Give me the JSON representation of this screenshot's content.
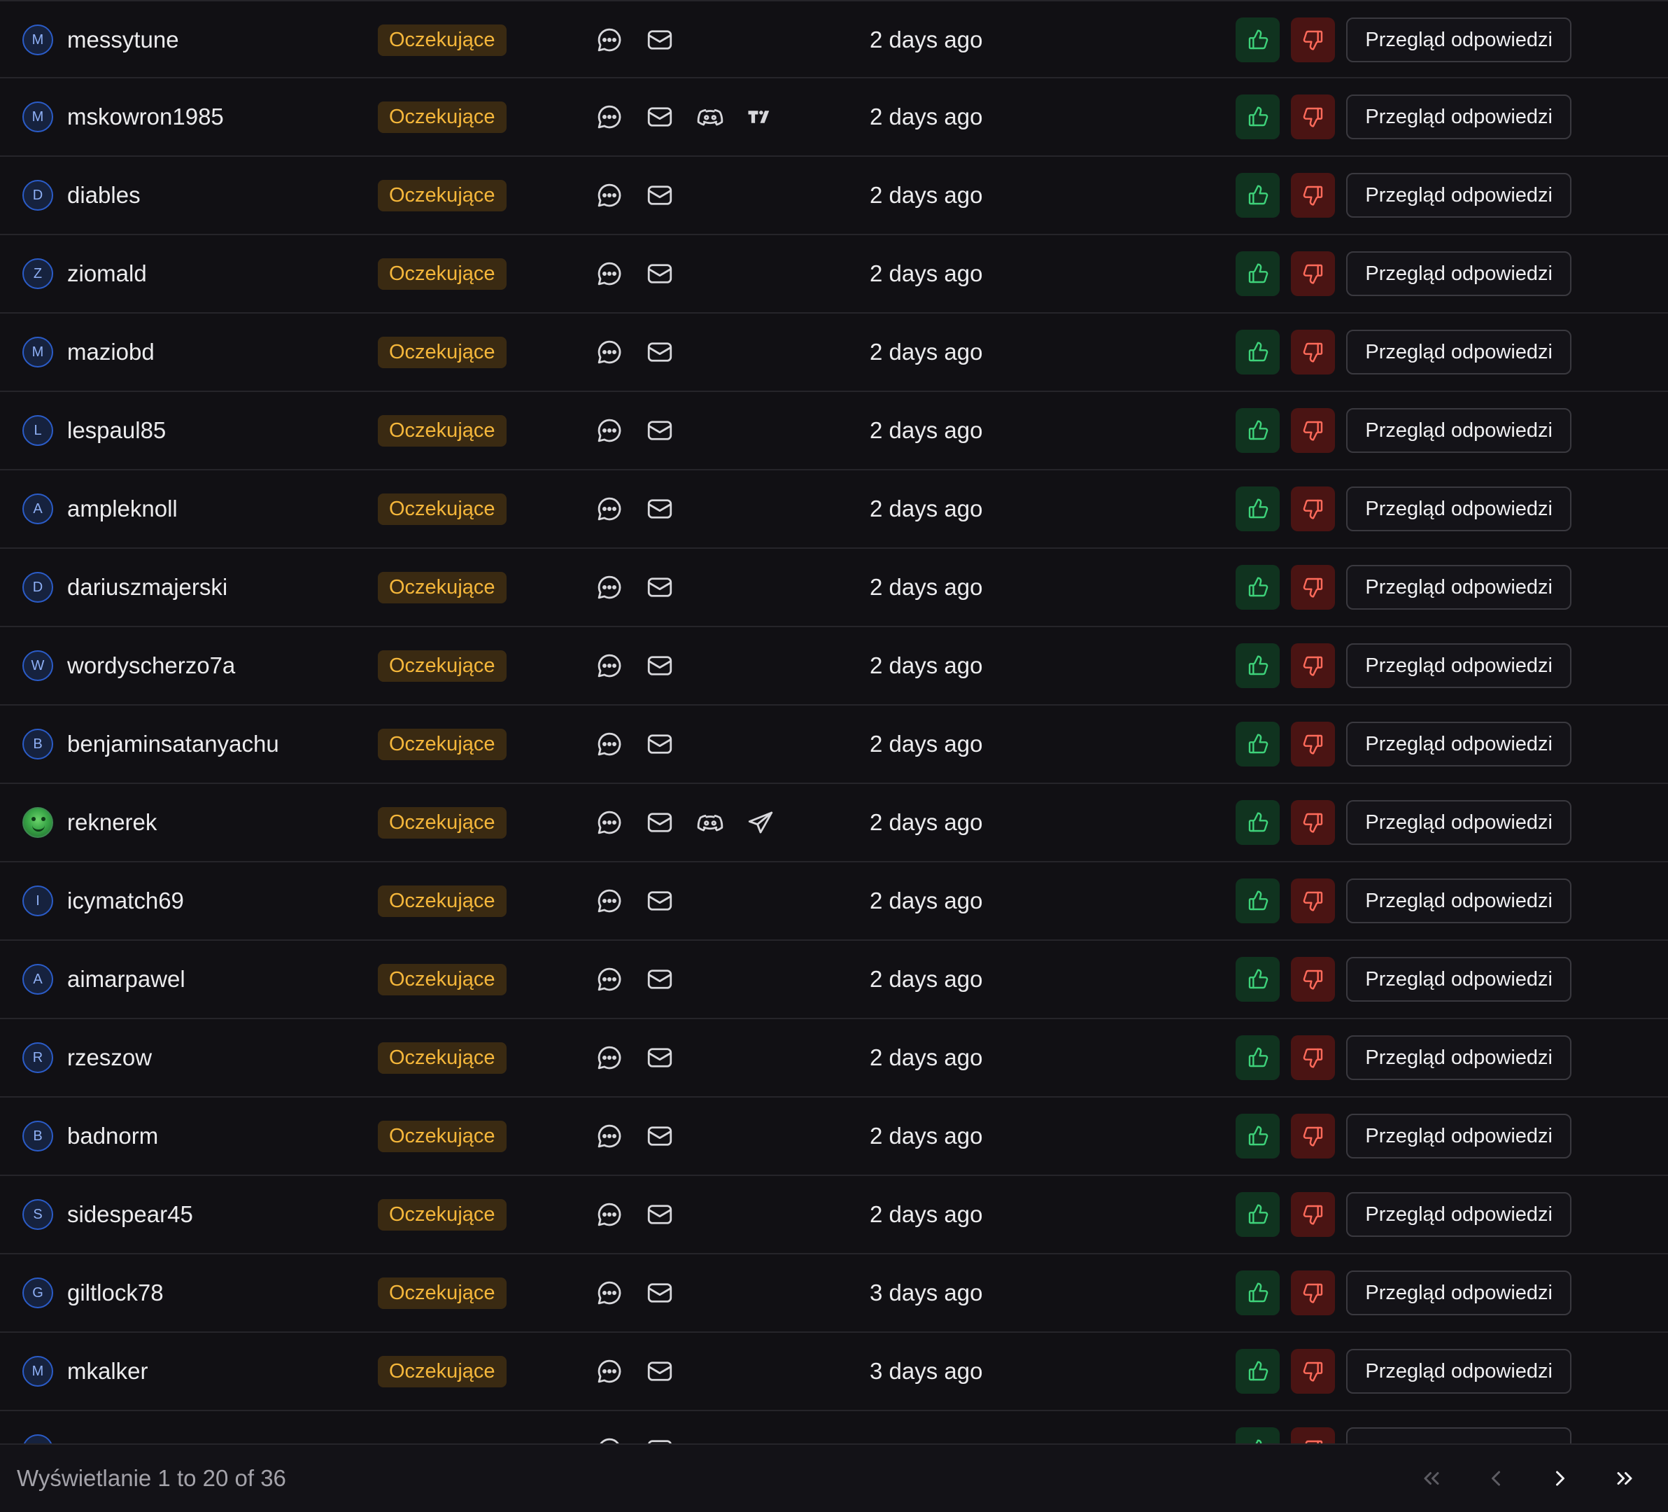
{
  "colors": {
    "background": "#111014",
    "badge_text": "#f5b73b",
    "badge_bg": "#3a2a12",
    "approve": "#3ed27a",
    "reject": "#ff6b5b"
  },
  "rows": [
    {
      "initial": "M",
      "username": "messytune",
      "status": "Oczekujące",
      "channels": [
        "chat-icon",
        "mail-icon"
      ],
      "time": "2 days ago",
      "review": "Przegląd odpowiedzi"
    },
    {
      "initial": "M",
      "username": "mskowron1985",
      "status": "Oczekujące",
      "channels": [
        "chat-icon",
        "mail-icon",
        "discord-icon",
        "tradingview-icon"
      ],
      "time": "2 days ago",
      "review": "Przegląd odpowiedzi"
    },
    {
      "initial": "D",
      "username": "diables",
      "status": "Oczekujące",
      "channels": [
        "chat-icon",
        "mail-icon"
      ],
      "time": "2 days ago",
      "review": "Przegląd odpowiedzi"
    },
    {
      "initial": "Z",
      "username": "ziomald",
      "status": "Oczekujące",
      "channels": [
        "chat-icon",
        "mail-icon"
      ],
      "time": "2 days ago",
      "review": "Przegląd odpowiedzi"
    },
    {
      "initial": "M",
      "username": "maziobd",
      "status": "Oczekujące",
      "channels": [
        "chat-icon",
        "mail-icon"
      ],
      "time": "2 days ago",
      "review": "Przegląd odpowiedzi"
    },
    {
      "initial": "L",
      "username": "lespaul85",
      "status": "Oczekujące",
      "channels": [
        "chat-icon",
        "mail-icon"
      ],
      "time": "2 days ago",
      "review": "Przegląd odpowiedzi"
    },
    {
      "initial": "A",
      "username": "ampleknoll",
      "status": "Oczekujące",
      "channels": [
        "chat-icon",
        "mail-icon"
      ],
      "time": "2 days ago",
      "review": "Przegląd odpowiedzi"
    },
    {
      "initial": "D",
      "username": "dariuszmajerski",
      "status": "Oczekujące",
      "channels": [
        "chat-icon",
        "mail-icon"
      ],
      "time": "2 days ago",
      "review": "Przegląd odpowiedzi"
    },
    {
      "initial": "W",
      "username": "wordyscherzo7a",
      "status": "Oczekujące",
      "channels": [
        "chat-icon",
        "mail-icon"
      ],
      "time": "2 days ago",
      "review": "Przegląd odpowiedzi"
    },
    {
      "initial": "B",
      "username": "benjaminsatanyachu",
      "status": "Oczekujące",
      "channels": [
        "chat-icon",
        "mail-icon"
      ],
      "time": "2 days ago",
      "review": "Przegląd odpowiedzi"
    },
    {
      "initial": "",
      "avatar_image": true,
      "username": "reknerek",
      "status": "Oczekujące",
      "channels": [
        "chat-icon",
        "mail-icon",
        "discord-icon",
        "telegram-icon"
      ],
      "time": "2 days ago",
      "review": "Przegląd odpowiedzi"
    },
    {
      "initial": "I",
      "username": "icymatch69",
      "status": "Oczekujące",
      "channels": [
        "chat-icon",
        "mail-icon"
      ],
      "time": "2 days ago",
      "review": "Przegląd odpowiedzi"
    },
    {
      "initial": "A",
      "username": "aimarpawel",
      "status": "Oczekujące",
      "channels": [
        "chat-icon",
        "mail-icon"
      ],
      "time": "2 days ago",
      "review": "Przegląd odpowiedzi"
    },
    {
      "initial": "R",
      "username": "rzeszow",
      "status": "Oczekujące",
      "channels": [
        "chat-icon",
        "mail-icon"
      ],
      "time": "2 days ago",
      "review": "Przegląd odpowiedzi"
    },
    {
      "initial": "B",
      "username": "badnorm",
      "status": "Oczekujące",
      "channels": [
        "chat-icon",
        "mail-icon"
      ],
      "time": "2 days ago",
      "review": "Przegląd odpowiedzi"
    },
    {
      "initial": "S",
      "username": "sidespear45",
      "status": "Oczekujące",
      "channels": [
        "chat-icon",
        "mail-icon"
      ],
      "time": "2 days ago",
      "review": "Przegląd odpowiedzi"
    },
    {
      "initial": "G",
      "username": "giltlock78",
      "status": "Oczekujące",
      "channels": [
        "chat-icon",
        "mail-icon"
      ],
      "time": "3 days ago",
      "review": "Przegląd odpowiedzi"
    },
    {
      "initial": "M",
      "username": "mkalker",
      "status": "Oczekujące",
      "channels": [
        "chat-icon",
        "mail-icon"
      ],
      "time": "3 days ago",
      "review": "Przegląd odpowiedzi"
    },
    {
      "initial": "",
      "username": "",
      "status": "",
      "channels": [
        "chat-icon",
        "mail-icon"
      ],
      "time": "",
      "review": "",
      "partial": true
    }
  ],
  "footer": {
    "summary": "Wyświetlanie 1 to 20 of 36",
    "pager": [
      {
        "icon": "chevrons-left-icon",
        "enabled": false
      },
      {
        "icon": "chevron-left-icon",
        "enabled": false
      },
      {
        "icon": "chevron-right-icon",
        "enabled": true
      },
      {
        "icon": "chevrons-right-icon",
        "enabled": true
      }
    ]
  }
}
